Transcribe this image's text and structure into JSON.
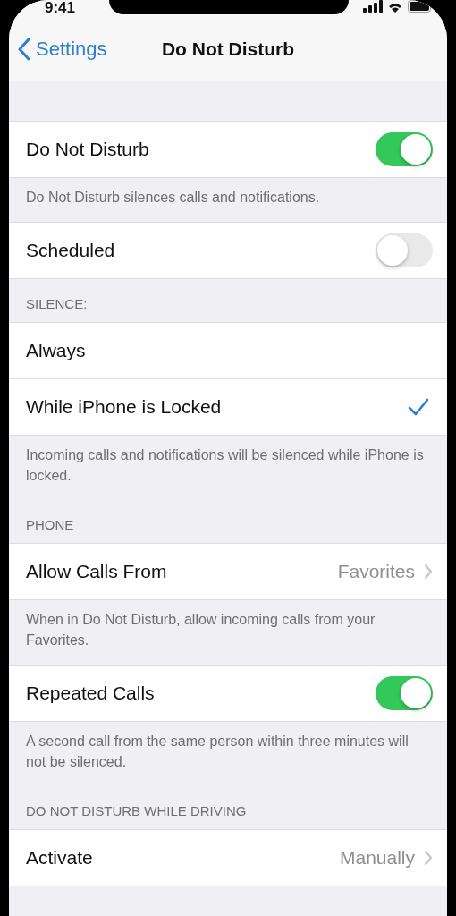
{
  "status_bar": {
    "time": "9:41"
  },
  "nav": {
    "back": "Settings",
    "title": "Do Not Disturb"
  },
  "groups": [
    {
      "rows": [
        {
          "kind": "toggle",
          "label": "Do Not Disturb",
          "on": true
        }
      ],
      "footer": "Do Not Disturb silences calls and notifications."
    },
    {
      "rows": [
        {
          "kind": "toggle",
          "label": "Scheduled",
          "on": false
        }
      ]
    },
    {
      "header": "SILENCE:",
      "rows": [
        {
          "kind": "check",
          "label": "Always",
          "selected": false
        },
        {
          "kind": "check",
          "label": "While iPhone is Locked",
          "selected": true
        }
      ],
      "footer": "Incoming calls and notifications will be silenced while iPhone is locked."
    },
    {
      "header": "PHONE",
      "rows": [
        {
          "kind": "disclosure",
          "label": "Allow Calls From",
          "value": "Favorites"
        }
      ],
      "footer": "When in Do Not Disturb, allow incoming calls from your Favorites."
    },
    {
      "rows": [
        {
          "kind": "toggle",
          "label": "Repeated Calls",
          "on": true
        }
      ],
      "footer": "A second call from the same person within three minutes will not be silenced."
    },
    {
      "header": "DO NOT DISTURB WHILE DRIVING",
      "rows": [
        {
          "kind": "disclosure",
          "label": "Activate",
          "value": "Manually"
        }
      ]
    }
  ]
}
